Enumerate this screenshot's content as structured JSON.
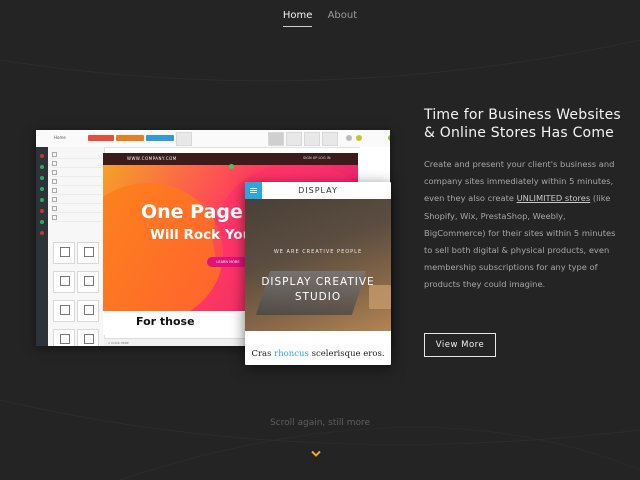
{
  "nav": {
    "home": "Home",
    "about": "About"
  },
  "hero": {
    "title": "Time for Business Websites & Online Stores Has Come",
    "body_before": "Create and present your client's business and company sites immediately within 5 minutes, even they also create ",
    "body_link": "UNLIMITED stores",
    "body_after": " (like Shopify, Wix, PrestaShop, Weebly, BigCommerce) for their sites within 5 minutes to sell both digital & physical products, even membership subscriptions for any type of products they could imagine.",
    "cta": "View More"
  },
  "builder": {
    "toolbar_home": "Home",
    "preview_logo": "WWW.COMPANY.COM",
    "preview_nav": "SIGN UP   LOG IN",
    "headline_1": "One Page W",
    "headline_2": "Will Rock Your",
    "learn_more": "LEARN MORE",
    "section_title": "For those",
    "bottom_bar": "▫ CLICK HERE"
  },
  "card": {
    "header": "DISPLAY",
    "tagline": "WE ARE CREATIVE PEOPLE",
    "title": "DISPLAY CREATIVE STUDIO",
    "footer_before": "Cras ",
    "footer_highlight": "rhoncus",
    "footer_after": " scelerisque eros."
  },
  "scroll_hint": "Scroll again, still more",
  "colors": {
    "background": "#242424",
    "accent": "#f5a623",
    "link_blue": "#29a8e0"
  },
  "icons": {
    "scroll": "chevron-down-icon",
    "card_menu": "hamburger-icon"
  }
}
